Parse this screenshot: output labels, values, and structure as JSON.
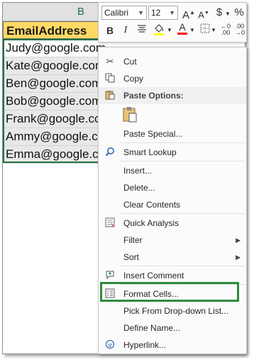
{
  "spreadsheet": {
    "column_letter": "B",
    "header_cell": "EmailAddress",
    "rows": [
      "Judy@google.com",
      "Kate@google.com",
      "Ben@google.com",
      "Bob@google.com",
      "Frank@google.com",
      "Ammy@google.com",
      "Emma@google.com"
    ]
  },
  "mini_toolbar": {
    "font_name": "Calibri",
    "font_size": "12",
    "grow_font": "A",
    "shrink_font": "A",
    "currency": "$",
    "percent": "%",
    "bold": "B",
    "italic": "I",
    "font_color_letter": "A",
    "accent_colors": {
      "fill": "#ffff00",
      "font": "#ff0000"
    }
  },
  "context_menu": {
    "cut": "Cut",
    "copy": "Copy",
    "paste_options": "Paste Options:",
    "paste_special": "Paste Special...",
    "smart_lookup": "Smart Lookup",
    "insert": "Insert...",
    "delete": "Delete...",
    "clear_contents": "Clear Contents",
    "quick_analysis": "Quick Analysis",
    "filter": "Filter",
    "sort": "Sort",
    "insert_comment": "Insert Comment",
    "format_cells": "Format Cells...",
    "pick_from_dropdown": "Pick From Drop-down List...",
    "define_name": "Define Name...",
    "hyperlink": "Hyperlink..."
  },
  "highlight_color": "#2e8b3e"
}
